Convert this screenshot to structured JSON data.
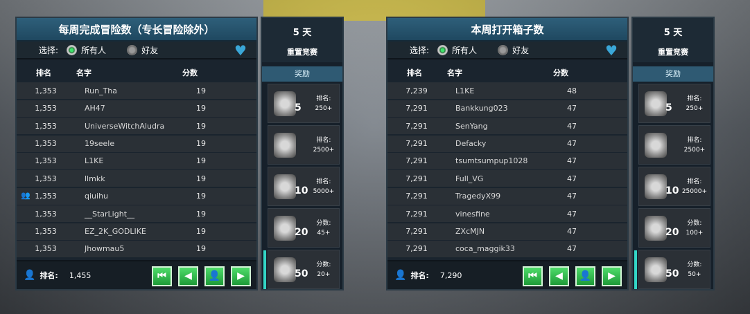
{
  "panels": [
    {
      "title": "每周完成冒险数（专长冒险除外）",
      "filter": {
        "label": "选择:",
        "option1": "所有人",
        "option2": "好友"
      },
      "columns": {
        "rank": "排名",
        "name": "名字",
        "score": "分数"
      },
      "rows": [
        {
          "rank": "1,353",
          "name": "Run_Tha",
          "score": "19"
        },
        {
          "rank": "1,353",
          "name": "AH47",
          "score": "19"
        },
        {
          "rank": "1,353",
          "name": "UniverseWitchAludra",
          "score": "19"
        },
        {
          "rank": "1,353",
          "name": "19seele",
          "score": "19"
        },
        {
          "rank": "1,353",
          "name": "L1KE",
          "score": "19"
        },
        {
          "rank": "1,353",
          "name": "llmkk",
          "score": "19"
        },
        {
          "rank": "1,353",
          "name": "qiuihu",
          "score": "19",
          "friend": true
        },
        {
          "rank": "1,353",
          "name": "__StarLight__",
          "score": "19"
        },
        {
          "rank": "1,353",
          "name": "EZ_2K_GODLIKE",
          "score": "19"
        },
        {
          "rank": "1,353",
          "name": "Jhowmau5",
          "score": "19"
        }
      ],
      "footer": {
        "label": "排名:",
        "value": "1,455"
      },
      "side": {
        "days": "5 天",
        "reset": "重置竞赛",
        "reward_header": "奖励",
        "rewards": [
          {
            "count": "5",
            "line1": "排名:",
            "line2": "250+"
          },
          {
            "count": "",
            "line1": "排名:",
            "line2": "2500+"
          },
          {
            "count": "10",
            "line1": "排名:",
            "line2": "5000+"
          },
          {
            "count": "20",
            "line1": "分数:",
            "line2": "45+"
          },
          {
            "count": "50",
            "line1": "分数:",
            "line2": "20+"
          }
        ]
      }
    },
    {
      "title": "本周打开箱子数",
      "filter": {
        "label": "选择:",
        "option1": "所有人",
        "option2": "好友"
      },
      "columns": {
        "rank": "排名",
        "name": "名字",
        "score": "分数"
      },
      "rows": [
        {
          "rank": "7,239",
          "name": "L1KE",
          "score": "48"
        },
        {
          "rank": "7,291",
          "name": "Bankkung023",
          "score": "47"
        },
        {
          "rank": "7,291",
          "name": "SenYang",
          "score": "47"
        },
        {
          "rank": "7,291",
          "name": "Defacky",
          "score": "47"
        },
        {
          "rank": "7,291",
          "name": "tsumtsumpup1028",
          "score": "47"
        },
        {
          "rank": "7,291",
          "name": "Full_VG",
          "score": "47"
        },
        {
          "rank": "7,291",
          "name": "TragedyX99",
          "score": "47"
        },
        {
          "rank": "7,291",
          "name": "vinesfine",
          "score": "47"
        },
        {
          "rank": "7,291",
          "name": "ZXcMJN",
          "score": "47"
        },
        {
          "rank": "7,291",
          "name": "coca_maggik33",
          "score": "47"
        }
      ],
      "footer": {
        "label": "排名:",
        "value": "7,290"
      },
      "side": {
        "days": "5 天",
        "reset": "重置竞赛",
        "reward_header": "奖励",
        "rewards": [
          {
            "count": "5",
            "line1": "排名:",
            "line2": "250+"
          },
          {
            "count": "",
            "line1": "排名:",
            "line2": "2500+"
          },
          {
            "count": "10",
            "line1": "排名:",
            "line2": "25000+"
          },
          {
            "count": "20",
            "line1": "分数:",
            "line2": "100+"
          },
          {
            "count": "50",
            "line1": "分数:",
            "line2": "50+"
          }
        ]
      }
    }
  ],
  "nav_buttons": [
    "⏮",
    "◀",
    "👤",
    "▶"
  ],
  "icons": {
    "user": "user-icon",
    "heart": "heart-icon",
    "friends": "friends-icon"
  }
}
